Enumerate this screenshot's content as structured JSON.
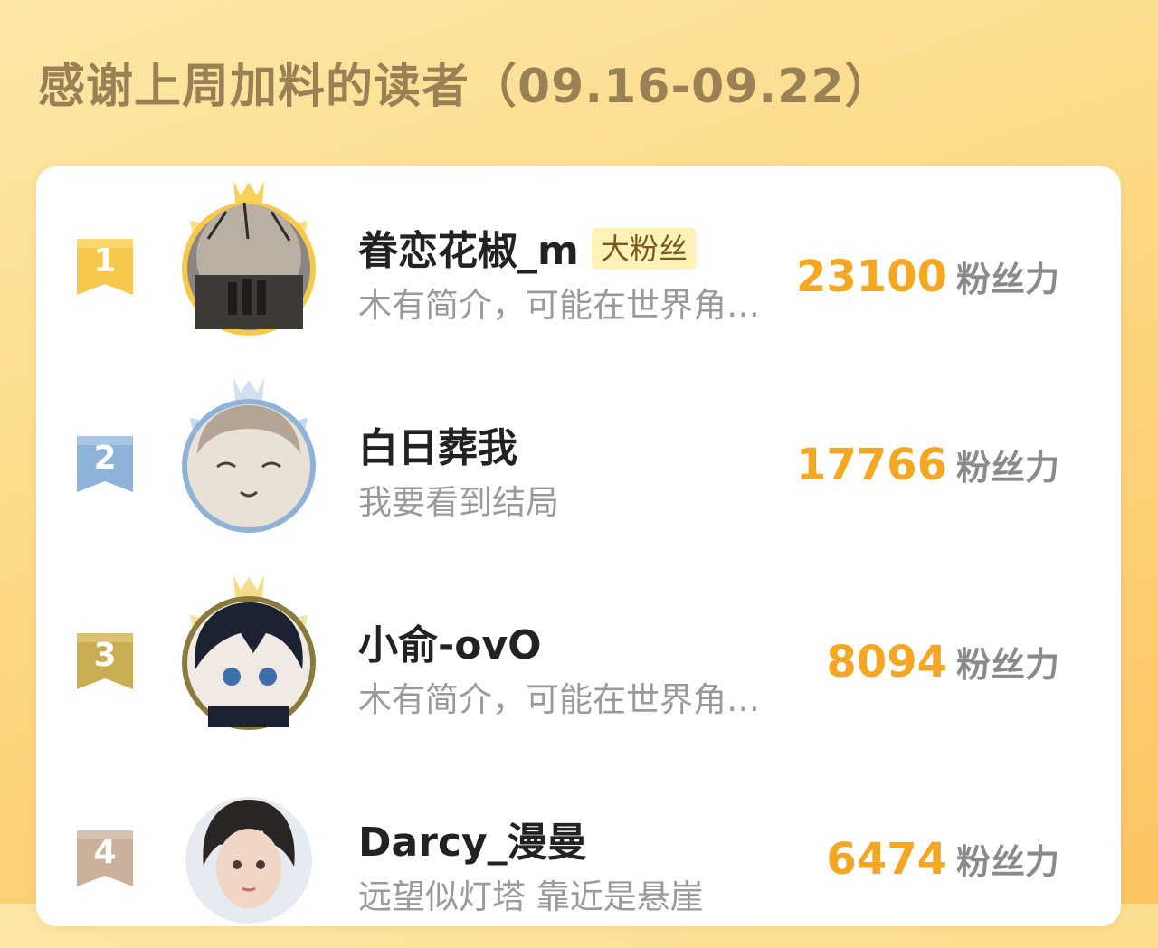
{
  "header": {
    "title": "感谢上周加料的读者（09.16-09.22）"
  },
  "colors": {
    "accent": "#f5a623",
    "title": "#9a8155",
    "rank1": "#f6c84b",
    "rank2": "#8fb2d9",
    "rank3": "#c9ad53",
    "rank4": "#c8b09a"
  },
  "leaderboard": [
    {
      "rank": "1",
      "name": "眷恋花椒_m",
      "badge": "大粉丝",
      "bio": "木有简介，可能在世界角…",
      "score": "23100",
      "unit": "粉丝力"
    },
    {
      "rank": "2",
      "name": "白日葬我",
      "badge": "",
      "bio": "我要看到结局",
      "score": "17766",
      "unit": "粉丝力"
    },
    {
      "rank": "3",
      "name": "小俞-ovO",
      "badge": "",
      "bio": "木有简介，可能在世界角…",
      "score": "8094",
      "unit": "粉丝力"
    },
    {
      "rank": "4",
      "name": "Darcy_漫曼",
      "badge": "",
      "bio": "远望似灯塔 靠近是悬崖",
      "score": "6474",
      "unit": "粉丝力"
    }
  ]
}
